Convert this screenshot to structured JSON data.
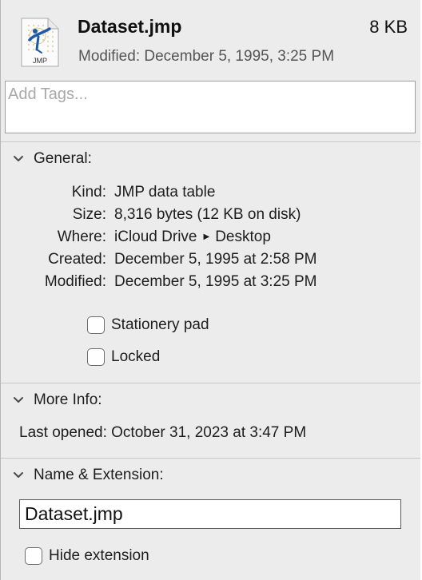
{
  "file": {
    "name": "Dataset.jmp",
    "size": "8 KB",
    "modified_prefix": "Modified:",
    "modified_value": "December 5, 1995, 3:25 PM",
    "icon_label": "JMP",
    "icon": "jmp-document-icon"
  },
  "tags": {
    "placeholder": "Add Tags..."
  },
  "general": {
    "title": "General:",
    "expanded": true,
    "kind_label": "Kind:",
    "kind_value": "JMP data table",
    "size_label": "Size:",
    "size_value": "8,316 bytes (12 KB on disk)",
    "where_label": "Where:",
    "where_parent": "iCloud Drive",
    "where_child": "Desktop",
    "created_label": "Created:",
    "created_value": "December 5, 1995 at 2:58 PM",
    "modified_label": "Modified:",
    "modified_value": "December 5, 1995 at 3:25 PM",
    "stationery_label": "Stationery pad",
    "stationery_checked": false,
    "locked_label": "Locked",
    "locked_checked": false
  },
  "more_info": {
    "title": "More Info:",
    "expanded": true,
    "last_opened_label": "Last opened:",
    "last_opened_value": "October 31, 2023 at 3:47 PM"
  },
  "name_extension": {
    "title": "Name & Extension:",
    "expanded": true,
    "name_value": "Dataset.jmp",
    "hide_extension_label": "Hide extension",
    "hide_extension_checked": false
  },
  "colors": {
    "background": "#ececec",
    "icon_blue": "#1f5aa6",
    "icon_ring": "#d8c68a"
  }
}
